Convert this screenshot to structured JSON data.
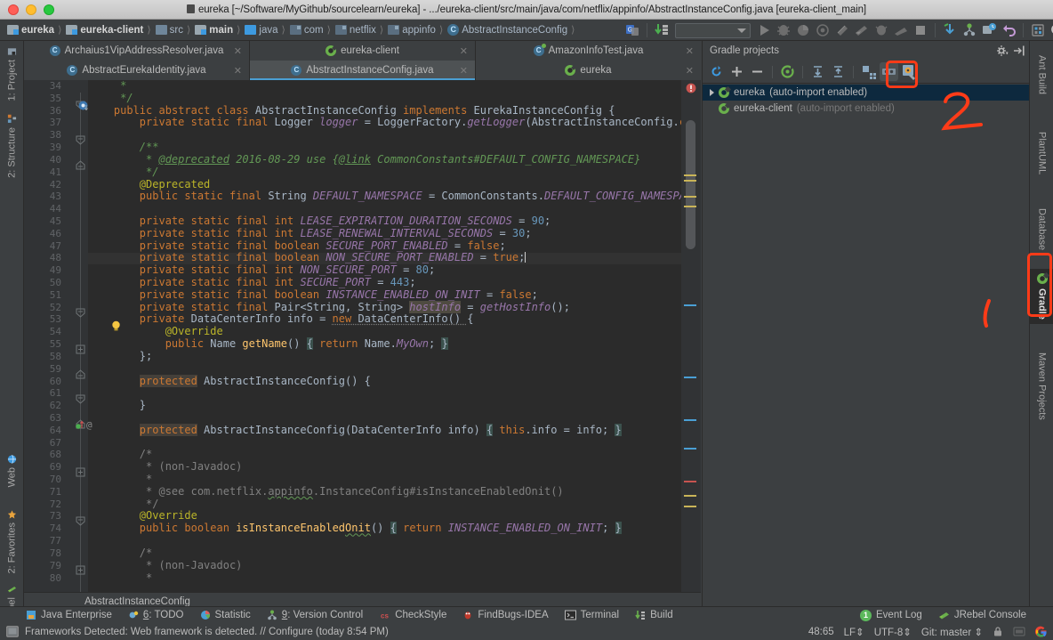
{
  "window": {
    "title": "eureka [~/Software/MyGithub/sourcelearn/eureka] - .../eureka-client/src/main/java/com/netflix/appinfo/AbstractInstanceConfig.java [eureka-client_main]"
  },
  "breadcrumbs": [
    {
      "label": "eureka",
      "icon": "module-icon",
      "bold": true
    },
    {
      "label": "eureka-client",
      "icon": "module-icon",
      "bold": true
    },
    {
      "label": "src",
      "icon": "folder-icon",
      "bold": false
    },
    {
      "label": "main",
      "icon": "source-folder-icon",
      "bold": true
    },
    {
      "label": "java",
      "icon": "source-folder-blue-icon",
      "bold": false
    },
    {
      "label": "com",
      "icon": "package-icon",
      "bold": false
    },
    {
      "label": "netflix",
      "icon": "package-icon",
      "bold": false
    },
    {
      "label": "appinfo",
      "icon": "package-icon",
      "bold": false
    },
    {
      "label": "AbstractInstanceConfig",
      "icon": "class-icon",
      "bold": false
    }
  ],
  "toolbar": {
    "run_config_placeholder": "",
    "buttons": [
      {
        "name": "sync-project-icon"
      },
      {
        "name": "update-project-icon"
      },
      {
        "name": "run-icon"
      },
      {
        "name": "debug-icon"
      },
      {
        "name": "run-with-coverage-icon"
      },
      {
        "name": "profile-icon"
      },
      {
        "name": "stop-build-icon"
      },
      {
        "name": "attach-debugger-icon"
      },
      {
        "name": "jrebel-run-icon"
      },
      {
        "name": "jrebel-debug-icon"
      },
      {
        "name": "stop-icon"
      },
      {
        "name": "update-vcs-icon"
      },
      {
        "name": "commit-vcs-icon"
      },
      {
        "name": "settings-icon"
      },
      {
        "name": "undo-icon"
      },
      {
        "name": "sdk-manager-icon"
      },
      {
        "name": "search-everywhere-icon"
      }
    ]
  },
  "editor_tabs_row1": [
    {
      "label": "Archaius1VipAddressResolver.java",
      "icon": "class-icon",
      "active": false
    },
    {
      "label": "eureka-client",
      "icon": "gradle-icon",
      "active": false
    },
    {
      "label": "AmazonInfoTest.java",
      "icon": "test-class-icon",
      "active": false
    }
  ],
  "editor_tabs_row2": [
    {
      "label": "AbstractEurekaIdentity.java",
      "icon": "class-icon",
      "active": false
    },
    {
      "label": "AbstractInstanceConfig.java",
      "icon": "class-icon",
      "active": true
    },
    {
      "label": "eureka",
      "icon": "gradle-icon",
      "active": false
    }
  ],
  "editor": {
    "breadcrumb": "AbstractInstanceConfig",
    "caret_line_number": 48,
    "line_numbers": [
      34,
      35,
      36,
      37,
      38,
      39,
      40,
      41,
      42,
      43,
      44,
      45,
      46,
      47,
      48,
      49,
      50,
      51,
      52,
      53,
      54,
      55,
      58,
      59,
      60,
      61,
      62,
      63,
      64,
      67,
      68,
      69,
      70,
      71,
      72,
      73,
      74,
      77,
      78,
      79,
      80
    ],
    "code_lines": [
      "     *",
      "     */",
      "    public abstract class AbstractInstanceConfig implements EurekaInstanceConfig {",
      "        private static final Logger logger = LoggerFactory.getLogger(AbstractInstanceConfig.class);",
      "",
      "        /**",
      "         * @deprecated 2016-08-29 use {@link CommonConstants#DEFAULT_CONFIG_NAMESPACE}",
      "         */",
      "        @Deprecated",
      "        public static final String DEFAULT_NAMESPACE = CommonConstants.DEFAULT_CONFIG_NAMESPACE;",
      "",
      "        private static final int LEASE_EXPIRATION_DURATION_SECONDS = 90;",
      "        private static final int LEASE_RENEWAL_INTERVAL_SECONDS = 30;",
      "        private static final boolean SECURE_PORT_ENABLED = false;",
      "        private static final boolean NON_SECURE_PORT_ENABLED = true;",
      "        private static final int NON_SECURE_PORT = 80;",
      "        private static final int SECURE_PORT = 443;",
      "        private static final boolean INSTANCE_ENABLED_ON_INIT = false;",
      "        private static final Pair<String, String> hostInfo = getHostInfo();",
      "        private DataCenterInfo info = new DataCenterInfo() {",
      "            @Override",
      "            public Name getName() { return Name.MyOwn; }",
      "        };",
      "",
      "        protected AbstractInstanceConfig() {",
      "",
      "        }",
      "",
      "        protected AbstractInstanceConfig(DataCenterInfo info) { this.info = info; }",
      "",
      "        /*",
      "         * (non-Javadoc)",
      "         *",
      "         * @see com.netflix.appinfo.InstanceConfig#isInstanceEnabledOnit()",
      "         */",
      "        @Override",
      "        public boolean isInstanceEnabledOnit() { return INSTANCE_ENABLED_ON_INIT; }",
      "",
      "        /*",
      "         * (non-Javadoc)",
      "         *"
    ]
  },
  "gradle_panel": {
    "title": "Gradle projects",
    "toolbar_buttons": [
      {
        "name": "refresh-all-gradle-projects-icon"
      },
      {
        "name": "attach-gradle-project-icon"
      },
      {
        "name": "detach-external-project-icon"
      },
      {
        "name": "execute-gradle-task-icon"
      },
      {
        "name": "expand-all-icon"
      },
      {
        "name": "collapse-all-icon"
      },
      {
        "name": "toggle-offline-mode-icon"
      },
      {
        "name": "show-diagram-icon"
      },
      {
        "name": "gradle-settings-icon"
      }
    ],
    "settings_icon": "gear-icon",
    "hide_icon": "hide-panel-icon",
    "tree": [
      {
        "label": "eureka",
        "suffix": "(auto-import enabled)",
        "selected": true,
        "expandable": true,
        "dimmed": false
      },
      {
        "label": "eureka-client",
        "suffix": "(auto-import enabled)",
        "selected": false,
        "expandable": false,
        "dimmed": true
      }
    ]
  },
  "left_tool_tabs": [
    {
      "label": "1: Project",
      "icon": "project-icon"
    },
    {
      "label": "2: Structure",
      "icon": "structure-icon"
    },
    {
      "label": "Web",
      "icon": "web-icon"
    },
    {
      "label": "2: Favorites",
      "icon": "star-icon"
    },
    {
      "label": "JRebel",
      "icon": "jrebel-icon"
    }
  ],
  "right_tool_tabs": [
    {
      "label": "Ant Build",
      "icon": "ant-icon"
    },
    {
      "label": "PlantUML",
      "icon": "plantuml-icon"
    },
    {
      "label": "Database",
      "icon": "database-icon"
    },
    {
      "label": "Gradle",
      "icon": "gradle-icon",
      "highlighted": true
    },
    {
      "label": "Maven Projects",
      "icon": "maven-icon"
    }
  ],
  "bottom_tool_tabs": [
    {
      "label": "Java Enterprise",
      "icon": "java-enterprise-icon",
      "mnemonic": ""
    },
    {
      "label": "6: TODO",
      "icon": "todo-icon",
      "mnemonic": "6"
    },
    {
      "label": "Statistic",
      "icon": "statistic-icon",
      "mnemonic": ""
    },
    {
      "label": "9: Version Control",
      "icon": "version-control-icon",
      "mnemonic": "9"
    },
    {
      "label": "CheckStyle",
      "icon": "checkstyle-icon",
      "mnemonic": ""
    },
    {
      "label": "FindBugs-IDEA",
      "icon": "findbugs-icon",
      "mnemonic": ""
    },
    {
      "label": "Terminal",
      "icon": "terminal-icon",
      "mnemonic": ""
    },
    {
      "label": "Build",
      "icon": "build-icon",
      "mnemonic": ""
    }
  ],
  "bottom_right_tabs": [
    {
      "label": "Event Log",
      "icon": "event-log-icon",
      "badge": "1"
    },
    {
      "label": "JRebel Console",
      "icon": "jrebel-icon",
      "badge": ""
    }
  ],
  "statusbar": {
    "message": "Frameworks Detected: Web framework is detected. // Configure (today 8:54 PM)",
    "caret_position": "48:65",
    "line_separator": "LF",
    "encoding": "UTF-8",
    "branch": "Git: master",
    "lock_icon": "lock-icon",
    "notification_icon": "google-icon"
  },
  "annotations": [
    {
      "type": "red-rectangle",
      "target": "gradle-settings-button"
    },
    {
      "type": "red-rectangle",
      "target": "gradle-right-tool-tab"
    },
    {
      "type": "red-handwriting",
      "text": "2"
    },
    {
      "type": "red-stroke",
      "text": ""
    }
  ],
  "colors": {
    "accent": "#4a9fd4",
    "selection": "#0d293e",
    "annotation": "#ff3b18",
    "keyword": "#cc7832",
    "number": "#6897bb",
    "javadoc": "#629755",
    "field": "#9876aa",
    "method": "#ffc66d",
    "annotation_text": "#bbb529"
  }
}
